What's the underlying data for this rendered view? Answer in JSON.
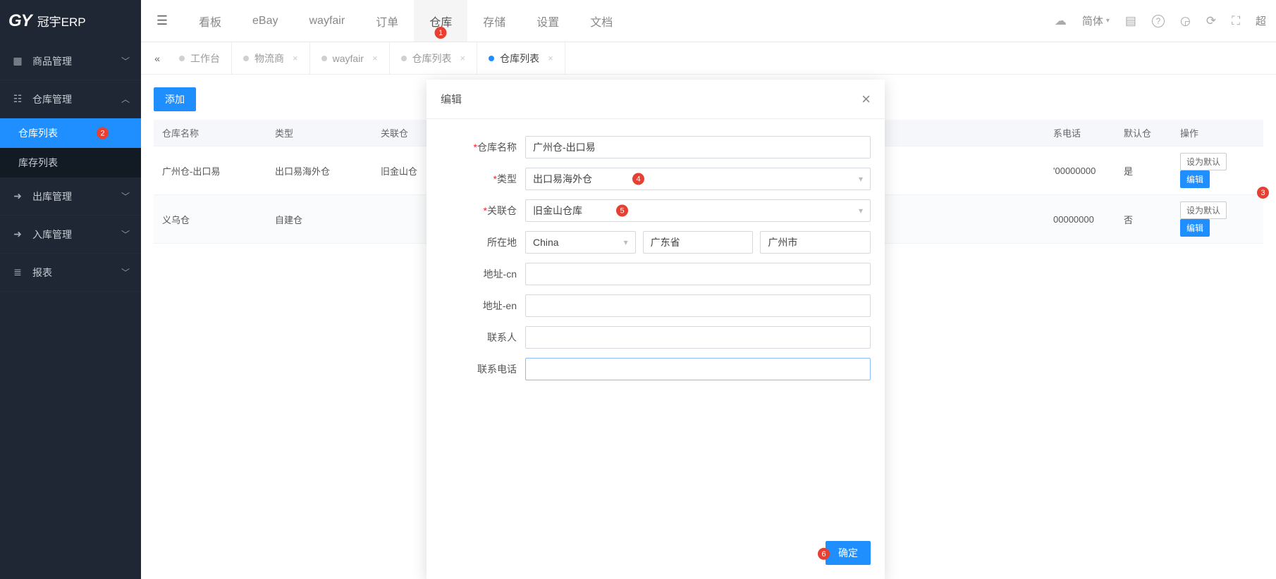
{
  "logo": {
    "brand": "GY",
    "name": "冠宇ERP"
  },
  "top_nav": [
    {
      "label": "看板"
    },
    {
      "label": "eBay"
    },
    {
      "label": "wayfair"
    },
    {
      "label": "订单"
    },
    {
      "label": "仓库",
      "active": true,
      "badge": "1"
    },
    {
      "label": "存储"
    },
    {
      "label": "设置"
    },
    {
      "label": "文档"
    }
  ],
  "top_right": {
    "lang": "简体",
    "overflow": "超"
  },
  "sidebar": [
    {
      "icon": "grid",
      "label": "商品管理",
      "chev": "down"
    },
    {
      "icon": "db",
      "label": "仓库管理",
      "chev": "up",
      "expanded": true,
      "children": [
        {
          "label": "仓库列表",
          "active": true,
          "badge": "2"
        },
        {
          "label": "库存列表"
        }
      ]
    },
    {
      "icon": "out",
      "label": "出库管理",
      "chev": "down"
    },
    {
      "icon": "in",
      "label": "入库管理",
      "chev": "down"
    },
    {
      "icon": "list",
      "label": "报表",
      "chev": "down"
    }
  ],
  "tabs": [
    {
      "label": "工作台"
    },
    {
      "label": "物流商",
      "closable": true
    },
    {
      "label": "wayfair",
      "closable": true
    },
    {
      "label": "仓库列表",
      "closable": true
    },
    {
      "label": "仓库列表",
      "closable": true,
      "active": true
    }
  ],
  "page": {
    "add_btn": "添加"
  },
  "table": {
    "columns": [
      "仓库名称",
      "类型",
      "关联仓",
      "",
      "系电话",
      "默认仓",
      "操作"
    ],
    "col_phone_partial": "系电话",
    "rows": [
      {
        "name": "广州仓-出口易",
        "type": "出口易海外仓",
        "rel": "旧金山仓",
        "phone_tail": "'00000000",
        "default": "是"
      },
      {
        "name": "义乌仓",
        "type": "自建仓",
        "rel": "",
        "phone_tail": "00000000",
        "default": "否"
      }
    ],
    "btn_set_default": "设为默认",
    "btn_edit": "编辑",
    "edit_badge": "3"
  },
  "dialog": {
    "title": "编辑",
    "labels": {
      "name": "仓库名称",
      "type": "类型",
      "rel": "关联仓",
      "loc": "所在地",
      "addr_cn": "地址-cn",
      "addr_en": "地址-en",
      "contact": "联系人",
      "phone": "联系电话"
    },
    "values": {
      "name": "广州仓-出口易",
      "type": "出口易海外仓",
      "rel": "旧金山仓库",
      "country": "China",
      "province": "广东省",
      "city": "广州市",
      "addr_cn": "",
      "addr_en": "",
      "contact": "",
      "phone": ""
    },
    "badges": {
      "type": "4",
      "rel": "5",
      "confirm": "6"
    },
    "confirm": "确定"
  }
}
